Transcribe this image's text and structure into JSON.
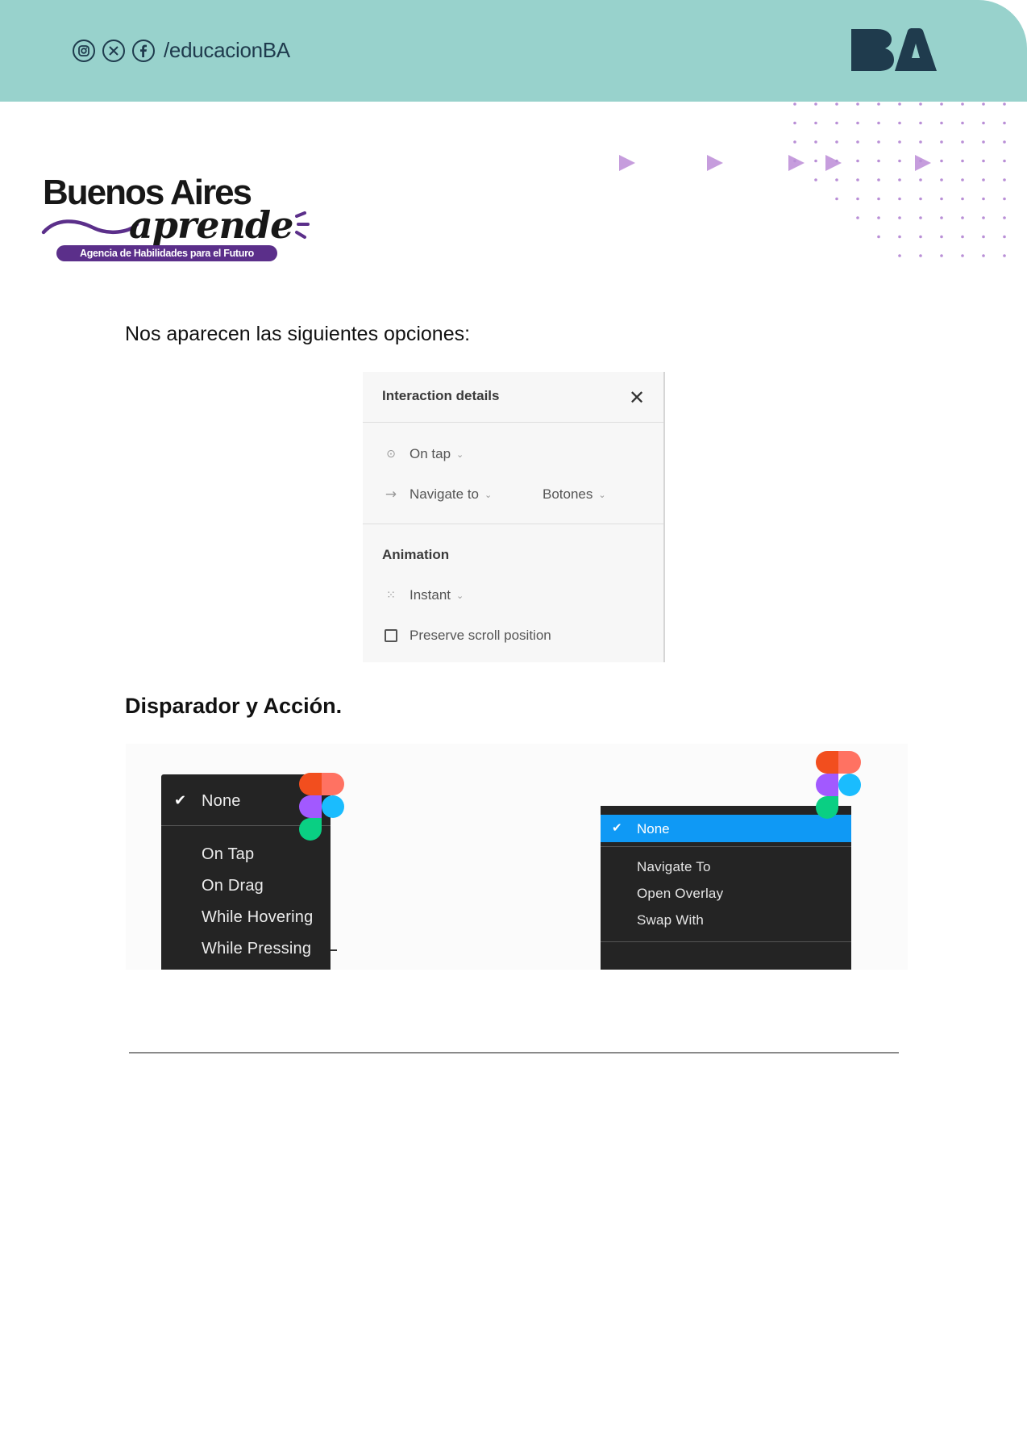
{
  "header": {
    "social_icons": [
      "instagram-icon",
      "x-icon",
      "facebook-icon"
    ],
    "handle": "/educacionBA",
    "logo_text": "BA",
    "colors": {
      "band": "#98d2cc",
      "logo": "#1f3b4d",
      "accent": "#b98fd6"
    }
  },
  "brand": {
    "line1": "Buenos Aires",
    "line2": "aprende",
    "tagline": "Agencia de Habilidades para el Futuro",
    "color": "#5b2f8a"
  },
  "intro_text": "Nos aparecen las siguientes opciones:",
  "interaction_panel": {
    "title": "Interaction details",
    "close_icon": "close-icon",
    "trigger": "On tap",
    "action": "Navigate to",
    "destination": "Botones",
    "animation_heading": "Animation",
    "animation": "Instant",
    "preserve_scroll": "Preserve scroll position"
  },
  "section_heading": "Disparador y Acción.",
  "trigger_menu": {
    "selected": "None",
    "items": [
      "On Tap",
      "On Drag",
      "While Hovering",
      "While Pressing"
    ]
  },
  "action_menu": {
    "selected": "None",
    "items": [
      "Navigate To",
      "Open Overlay",
      "Swap With"
    ],
    "highlight": "#0f99f5"
  }
}
